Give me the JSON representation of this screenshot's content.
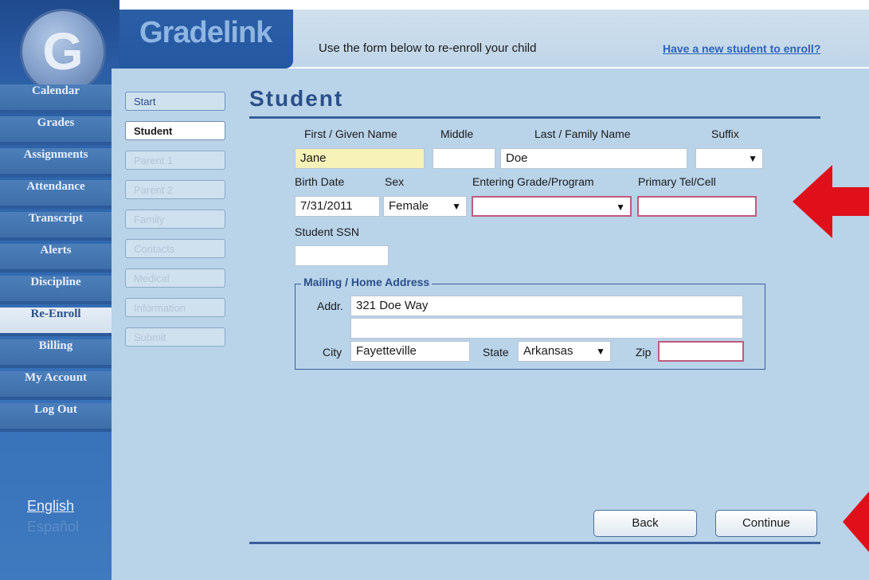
{
  "brand": {
    "name": "Gradelink",
    "logo_letter": "G"
  },
  "header": {
    "instruction": "Use the form below to re-enroll your child",
    "new_student_link": "Have a new student to enroll?"
  },
  "nav": {
    "items": [
      {
        "label": "Calendar"
      },
      {
        "label": "Grades"
      },
      {
        "label": "Assignments"
      },
      {
        "label": "Attendance"
      },
      {
        "label": "Transcript"
      },
      {
        "label": "Alerts"
      },
      {
        "label": "Discipline"
      },
      {
        "label": "Re-Enroll",
        "active": true
      },
      {
        "label": "Billing"
      },
      {
        "label": "My Account"
      },
      {
        "label": "Log Out"
      }
    ],
    "languages": {
      "english": "English",
      "spanish": "Español"
    }
  },
  "steps": [
    {
      "label": "Start",
      "state": "link"
    },
    {
      "label": "Student",
      "state": "current"
    },
    {
      "label": "Parent 1",
      "state": "disabled"
    },
    {
      "label": "Parent 2",
      "state": "disabled"
    },
    {
      "label": "Family",
      "state": "disabled"
    },
    {
      "label": "Contacts",
      "state": "disabled"
    },
    {
      "label": "Medical",
      "state": "disabled"
    },
    {
      "label": "Information",
      "state": "disabled"
    },
    {
      "label": "Submit",
      "state": "disabled"
    }
  ],
  "form": {
    "title": "Student",
    "labels": {
      "first_name": "First / Given Name",
      "middle": "Middle",
      "last_name": "Last / Family Name",
      "suffix": "Suffix",
      "birth_date": "Birth Date",
      "sex": "Sex",
      "grade": "Entering Grade/Program",
      "phone": "Primary Tel/Cell",
      "ssn": "Student SSN"
    },
    "values": {
      "first_name": "Jane",
      "middle": "",
      "last_name": "Doe",
      "suffix": "",
      "birth_date": "7/31/2011",
      "sex": "Female",
      "grade": "",
      "phone": "",
      "ssn": ""
    },
    "address": {
      "legend": "Mailing / Home Address",
      "addr_label": "Addr.",
      "addr_line1": "321 Doe Way",
      "addr_line2": "",
      "city_label": "City",
      "city": "Fayetteville",
      "state_label": "State",
      "state": "Arkansas",
      "zip_label": "Zip",
      "zip": ""
    }
  },
  "buttons": {
    "back": "Back",
    "continue": "Continue"
  },
  "colors": {
    "required_border": "#c05a7c",
    "annotation_arrow": "#e0101a",
    "accent": "#2b4f8a"
  },
  "select_arrow_glyph": "▼"
}
